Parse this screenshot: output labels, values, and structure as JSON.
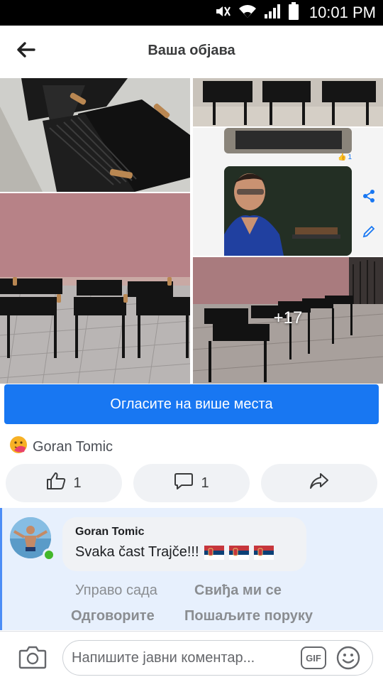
{
  "status_bar": {
    "time": "10:01 PM",
    "icons": [
      "mute-icon",
      "wifi-icon",
      "signal-icon",
      "battery-icon"
    ]
  },
  "header": {
    "title": "Ваша објава",
    "back_icon": "arrow-left-icon"
  },
  "gallery": {
    "more_count": "+17",
    "like_count_small": "1",
    "side_icons": [
      "share-icon",
      "edit-icon"
    ]
  },
  "promote": {
    "label": "Огласите на више места"
  },
  "reactions": {
    "reactor_name": "Goran Tomic",
    "reaction_icon": "care-emoji-icon"
  },
  "actions": {
    "like_count": "1",
    "comment_count": "1",
    "share_icon": "share-arrow-icon"
  },
  "comment": {
    "author": "Goran Tomic",
    "text": "Svaka čast Trajče!!!",
    "flags": [
      "serbia-flag",
      "serbia-flag",
      "serbia-flag"
    ],
    "time": "Управо сада",
    "like_label": "Свиђа ми се",
    "reply_label": "Одговорите",
    "message_label": "Пошаљите поруку"
  },
  "composer": {
    "placeholder": "Напишите јавни коментар...",
    "gif_label": "GIF",
    "camera_icon": "camera-icon",
    "emoji_icon": "smiley-icon"
  },
  "colors": {
    "brand_blue": "#1877f2",
    "comment_highlight": "#e7f0fd",
    "online_green": "#42b72a"
  }
}
